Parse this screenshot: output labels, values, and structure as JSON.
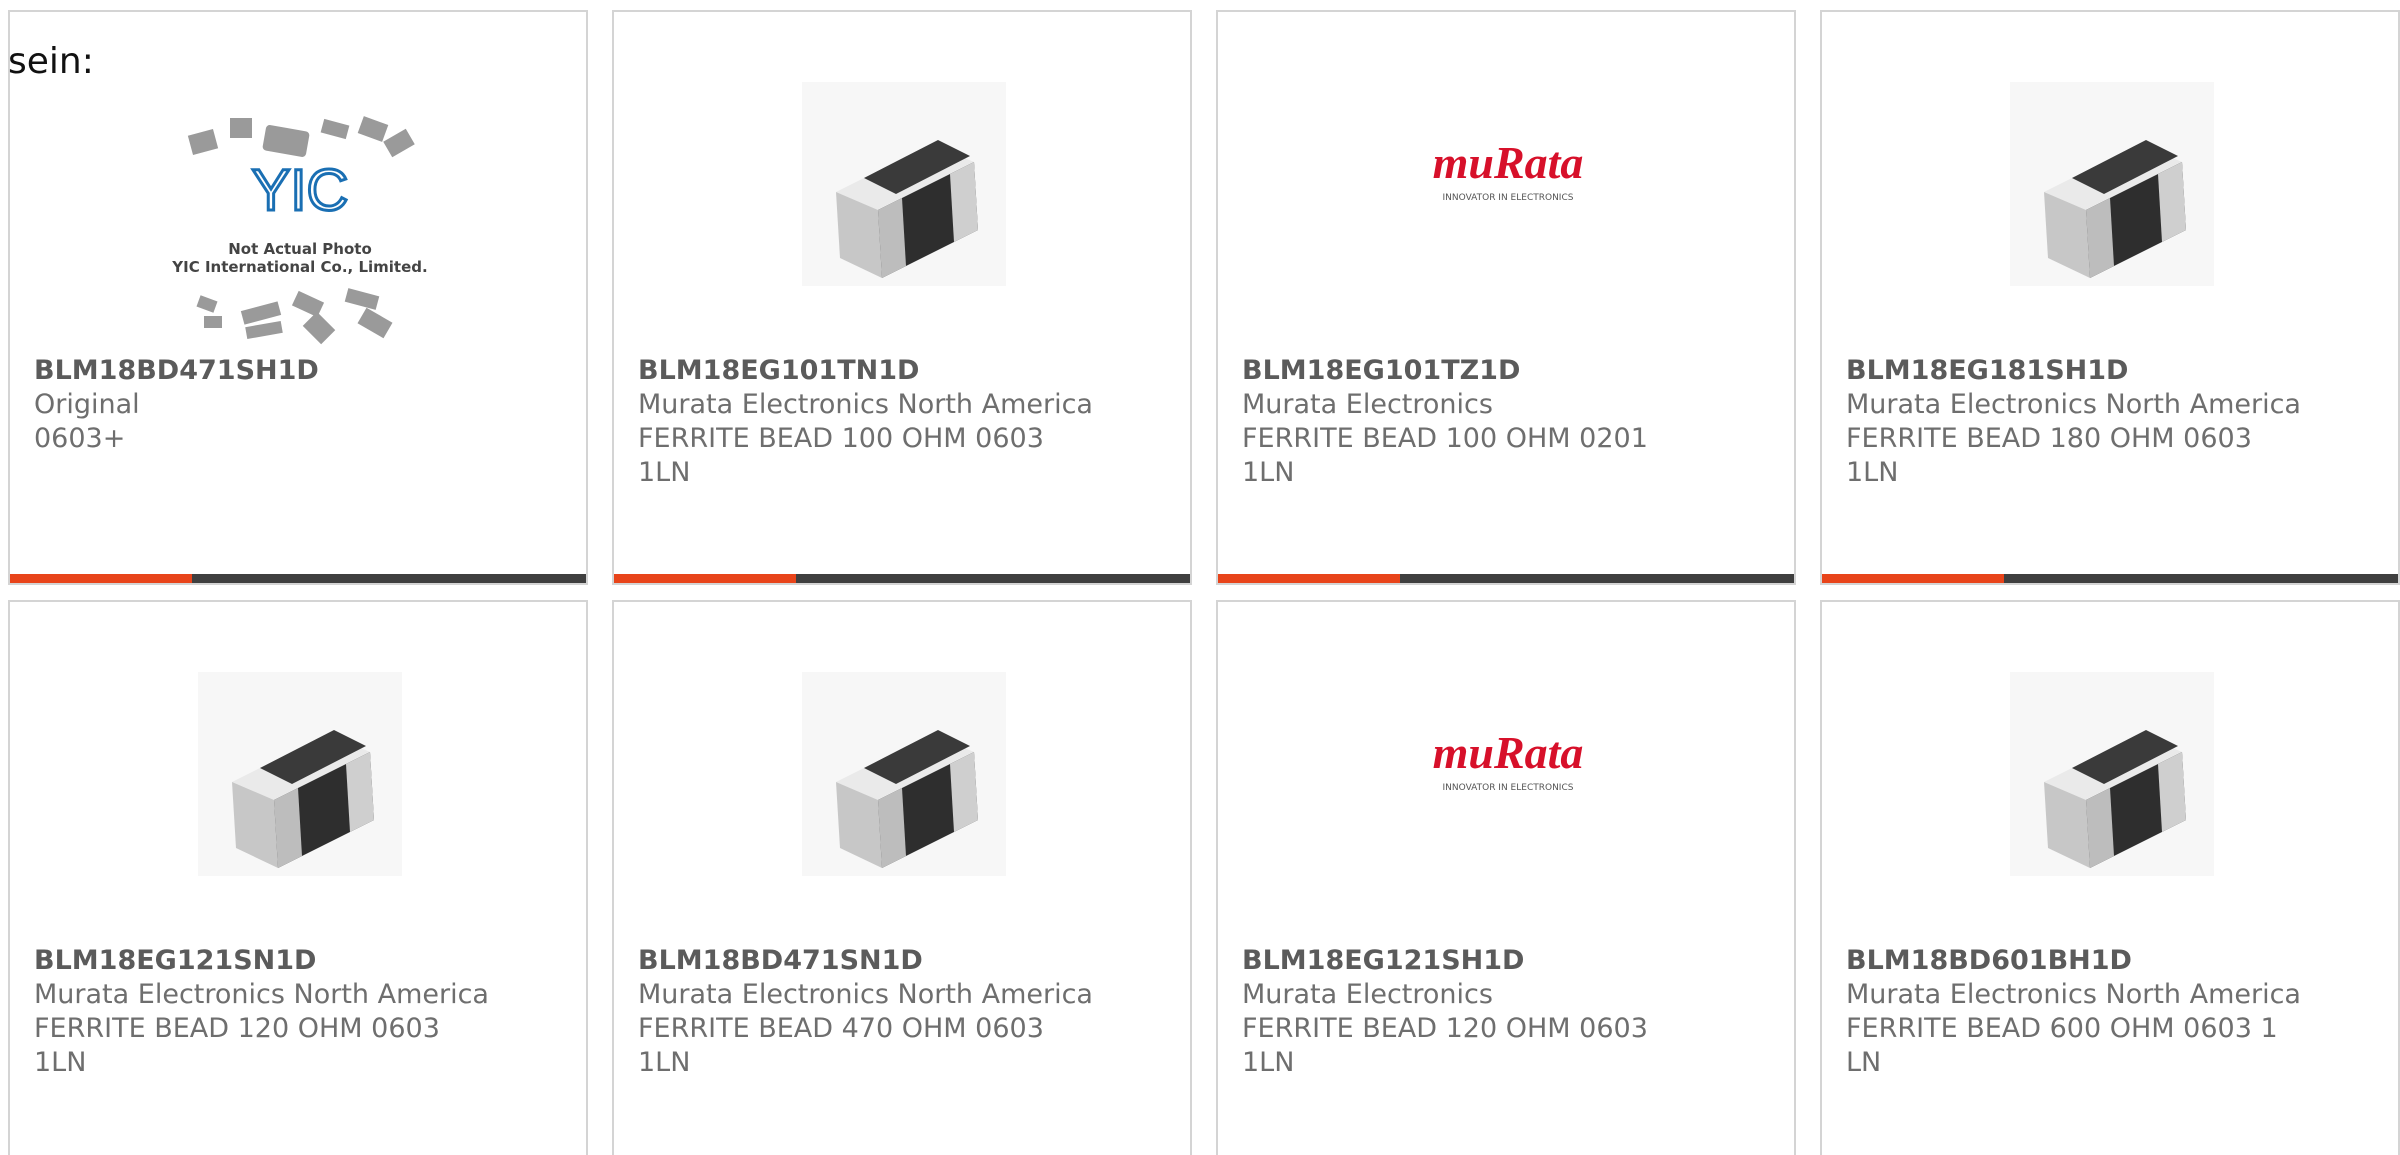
{
  "heading": "sein:",
  "colors": {
    "accent": "#e8441a",
    "bar": "#3f3f3f",
    "murata_red": "#d7102a"
  },
  "image_text": {
    "yic_logo": "YIC",
    "yic_caption_line1": "Not Actual Photo",
    "yic_caption_line2": "YIC International Co., Limited.",
    "murata_logo": "muRata",
    "murata_tagline": "INNOVATOR IN ELECTRONICS"
  },
  "products": [
    {
      "image": "yic-placeholder-photo",
      "part_number": "BLM18BD471SH1D",
      "manufacturer": "Original",
      "description": "0603+",
      "description2": ""
    },
    {
      "image": "chip-ferrite-bead-photo",
      "part_number": "BLM18EG101TN1D",
      "manufacturer": "Murata Electronics North America",
      "description": "FERRITE BEAD 100 OHM 0603",
      "description2": "1LN"
    },
    {
      "image": "murata-logo",
      "part_number": "BLM18EG101TZ1D",
      "manufacturer": "Murata Electronics",
      "description": "FERRITE BEAD 100 OHM 0201",
      "description2": "1LN"
    },
    {
      "image": "chip-ferrite-bead-photo",
      "part_number": "BLM18EG181SH1D",
      "manufacturer": "Murata Electronics North America",
      "description": "FERRITE BEAD 180 OHM 0603",
      "description2": "1LN"
    },
    {
      "image": "chip-ferrite-bead-photo",
      "part_number": "BLM18EG121SN1D",
      "manufacturer": "Murata Electronics North America",
      "description": "FERRITE BEAD 120 OHM 0603",
      "description2": "1LN"
    },
    {
      "image": "chip-ferrite-bead-photo",
      "part_number": "BLM18BD471SN1D",
      "manufacturer": "Murata Electronics North America",
      "description": "FERRITE BEAD 470 OHM 0603",
      "description2": "1LN"
    },
    {
      "image": "murata-logo",
      "part_number": "BLM18EG121SH1D",
      "manufacturer": "Murata Electronics",
      "description": "FERRITE BEAD 120 OHM 0603",
      "description2": "1LN"
    },
    {
      "image": "chip-ferrite-bead-photo",
      "part_number": "BLM18BD601BH1D",
      "manufacturer": "Murata Electronics North America",
      "description": "FERRITE BEAD 600 OHM 0603 1",
      "description2": "LN"
    }
  ]
}
